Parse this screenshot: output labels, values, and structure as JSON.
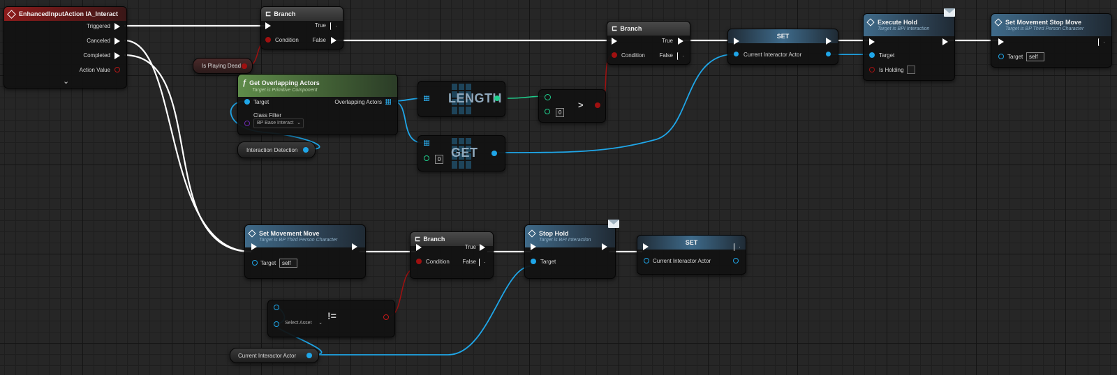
{
  "event_node": {
    "title": "EnhancedInputAction IA_Interact",
    "pins": [
      "Triggered",
      "Canceled",
      "Completed",
      "Action Value"
    ],
    "expand_glyph": "⌄"
  },
  "branch1": {
    "title": "Branch",
    "condition": "Condition",
    "true_label": "True",
    "false_label": "False"
  },
  "is_playing_dead": {
    "label": "Is Playing Dead"
  },
  "get_overlapping": {
    "title": "Get Overlapping Actors",
    "subtitle": "Target is Primitive Component",
    "target": "Target",
    "class_filter": "Class Filter",
    "class_value": "BP Base Interact",
    "overlapping_actors": "Overlapping Actors",
    "icon_glyph": "ƒ"
  },
  "interaction_detection": {
    "label": "Interaction Detection"
  },
  "length_node": {
    "label": "LENGTH"
  },
  "get_node": {
    "label": "GET",
    "index": "0"
  },
  "greater_node": {
    "op": ">",
    "value": "0"
  },
  "branch2": {
    "title": "Branch",
    "condition": "Condition",
    "true_label": "True",
    "false_label": "False"
  },
  "set1": {
    "title": "SET",
    "pin": "Current Interactor Actor"
  },
  "execute_hold": {
    "title": "Execute Hold",
    "subtitle": "Target is BPI Interaction",
    "target": "Target",
    "is_holding": "Is Holding"
  },
  "set_stop_move": {
    "title": "Set Movement Stop Move",
    "subtitle": "Target is BP Third Person Character",
    "target": "Target",
    "self_value": "self"
  },
  "set_move": {
    "title": "Set Movement Move",
    "subtitle": "Target is BP Third Person Character",
    "target": "Target",
    "self_value": "self"
  },
  "branch3": {
    "title": "Branch",
    "condition": "Condition",
    "true_label": "True",
    "false_label": "False"
  },
  "stop_hold": {
    "title": "Stop Hold",
    "subtitle": "Target is BPI Interaction",
    "target": "Target"
  },
  "set2": {
    "title": "SET",
    "pin": "Current Interactor Actor"
  },
  "not_equal": {
    "op": "!=",
    "select": "Select Asset"
  },
  "current_interactor_var": {
    "label": "Current Interactor Actor"
  },
  "colors": {
    "exec": "#ffffff",
    "object": "#1fa6e8",
    "bool": "#a01010",
    "int": "#20d08e",
    "class": "#6a2ab0"
  }
}
